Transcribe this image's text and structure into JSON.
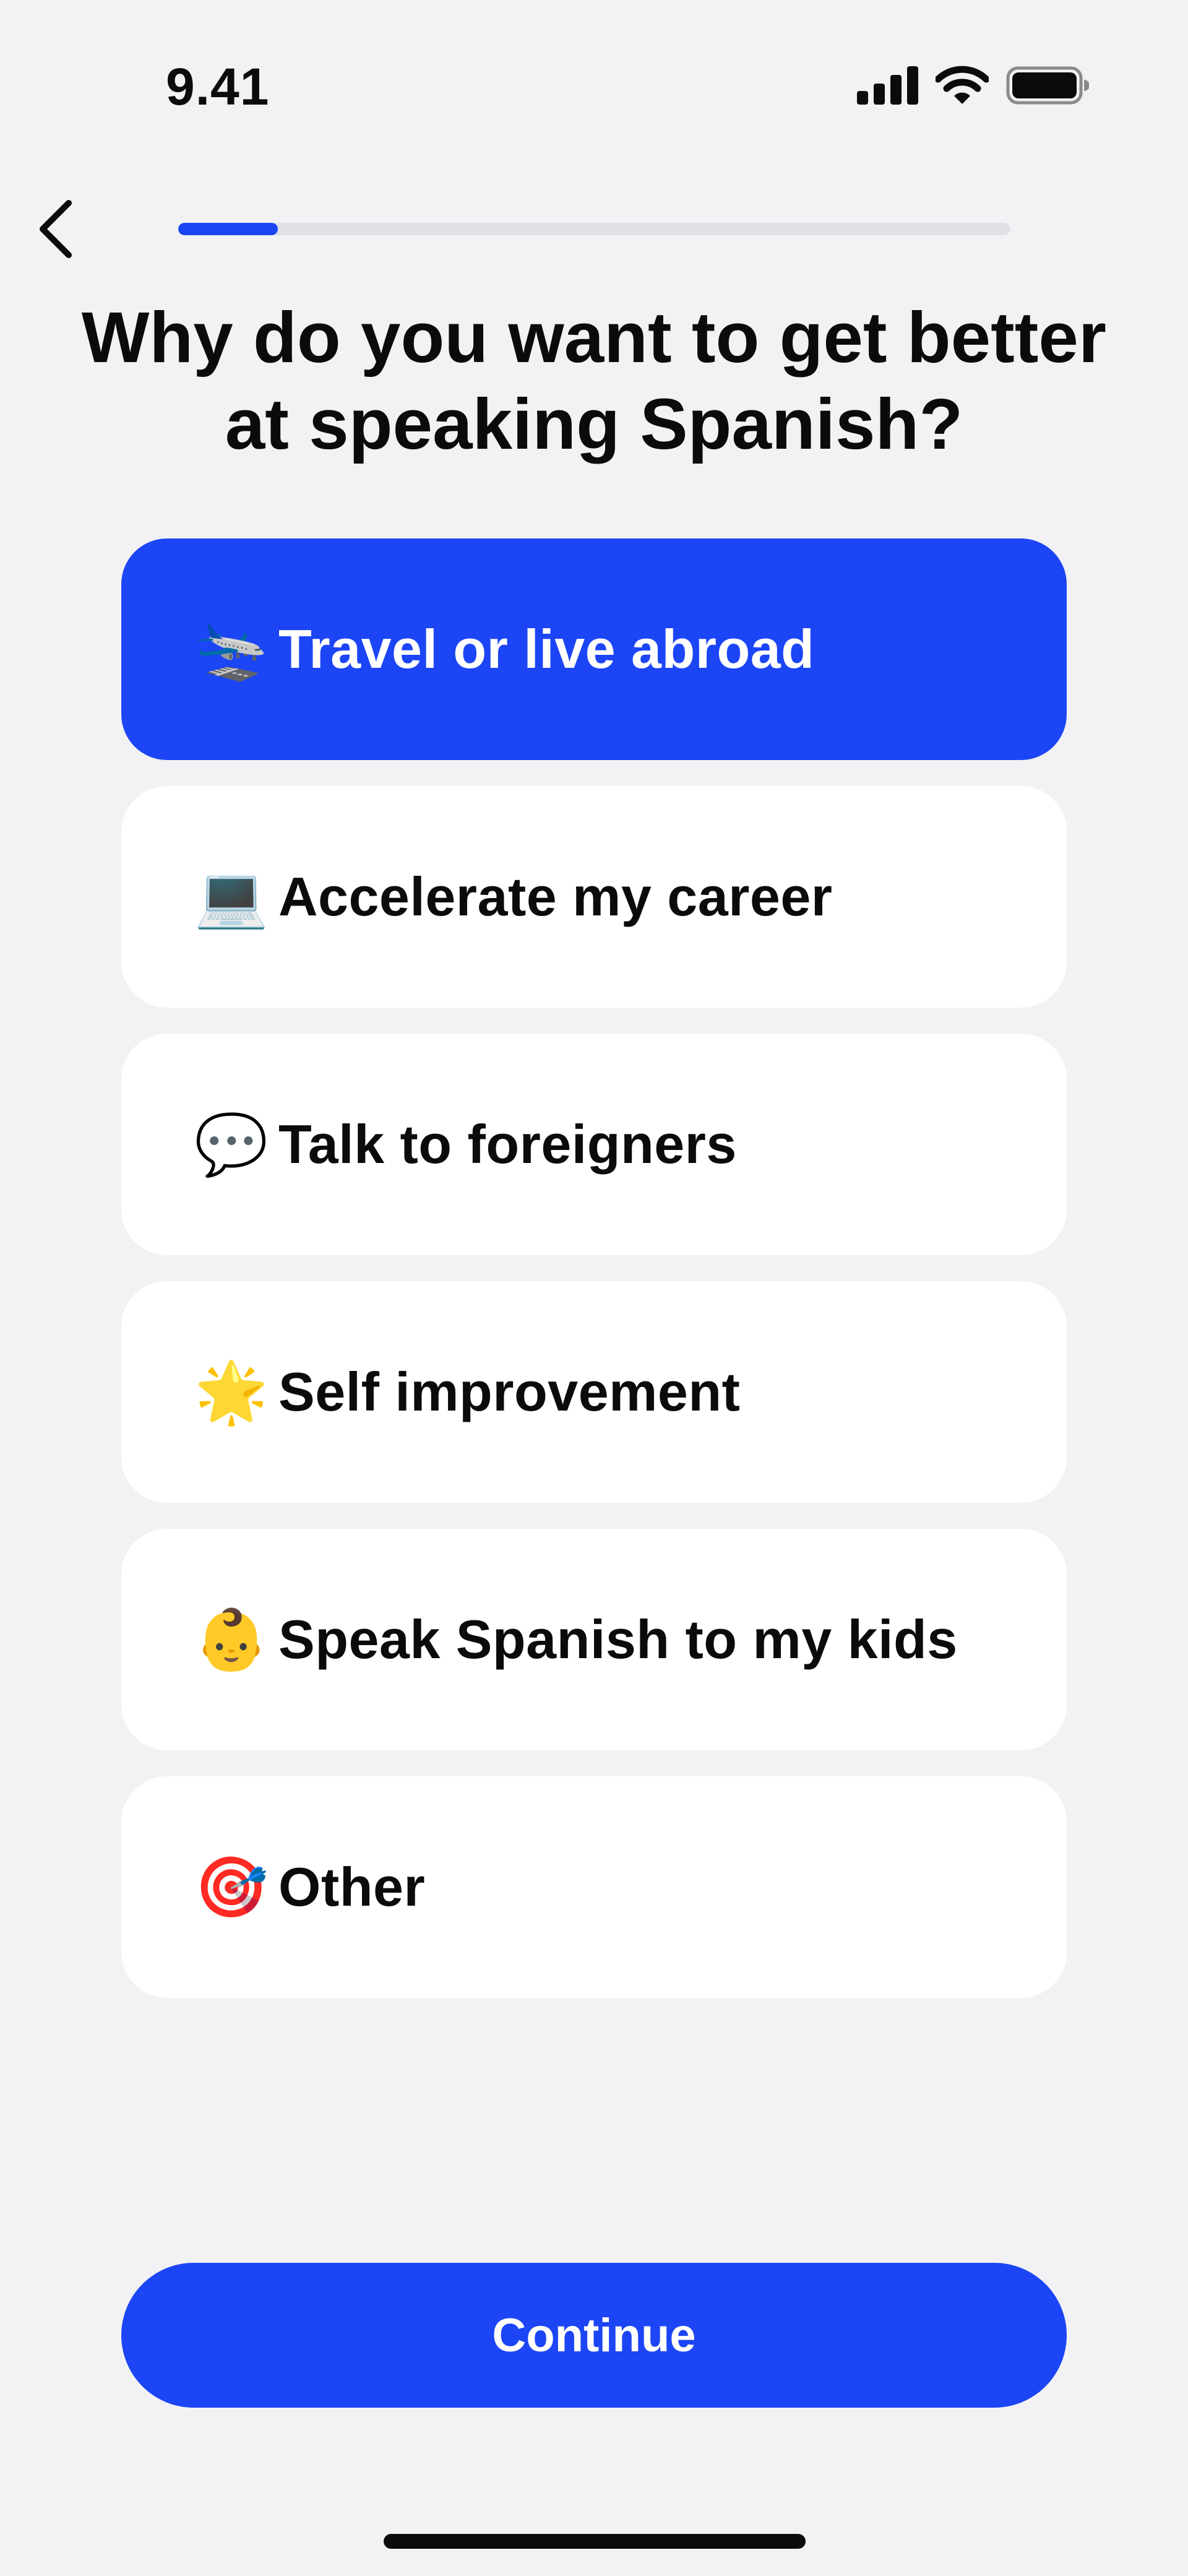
{
  "status_bar": {
    "time": "9.41",
    "icons": [
      "cellular-signal-icon",
      "wifi-icon",
      "battery-icon"
    ]
  },
  "nav": {
    "back_icon": "chevron-left-icon",
    "progress_percent": 12
  },
  "question": {
    "title": "Why do you want to get better at speaking Spanish?"
  },
  "options": [
    {
      "emoji": "🛬",
      "icon": "airplane-icon",
      "label": "Travel or live abroad",
      "selected": true
    },
    {
      "emoji": "💻",
      "icon": "laptop-icon",
      "label": "Accelerate my career",
      "selected": false
    },
    {
      "emoji": "💬",
      "icon": "speech-bubble-icon",
      "label": "Talk to foreigners",
      "selected": false
    },
    {
      "emoji": "🌟",
      "icon": "star-icon",
      "label": "Self improvement",
      "selected": false
    },
    {
      "emoji": "👶",
      "icon": "baby-face-icon",
      "label": "Speak Spanish to my kids",
      "selected": false
    },
    {
      "emoji": "🎯",
      "icon": "target-icon",
      "label": "Other",
      "selected": false
    }
  ],
  "continue_label": "Continue",
  "colors": {
    "accent": "#1c45f5",
    "background": "#f2f2f4",
    "card": "#ffffff",
    "track": "#dfe0e6"
  }
}
